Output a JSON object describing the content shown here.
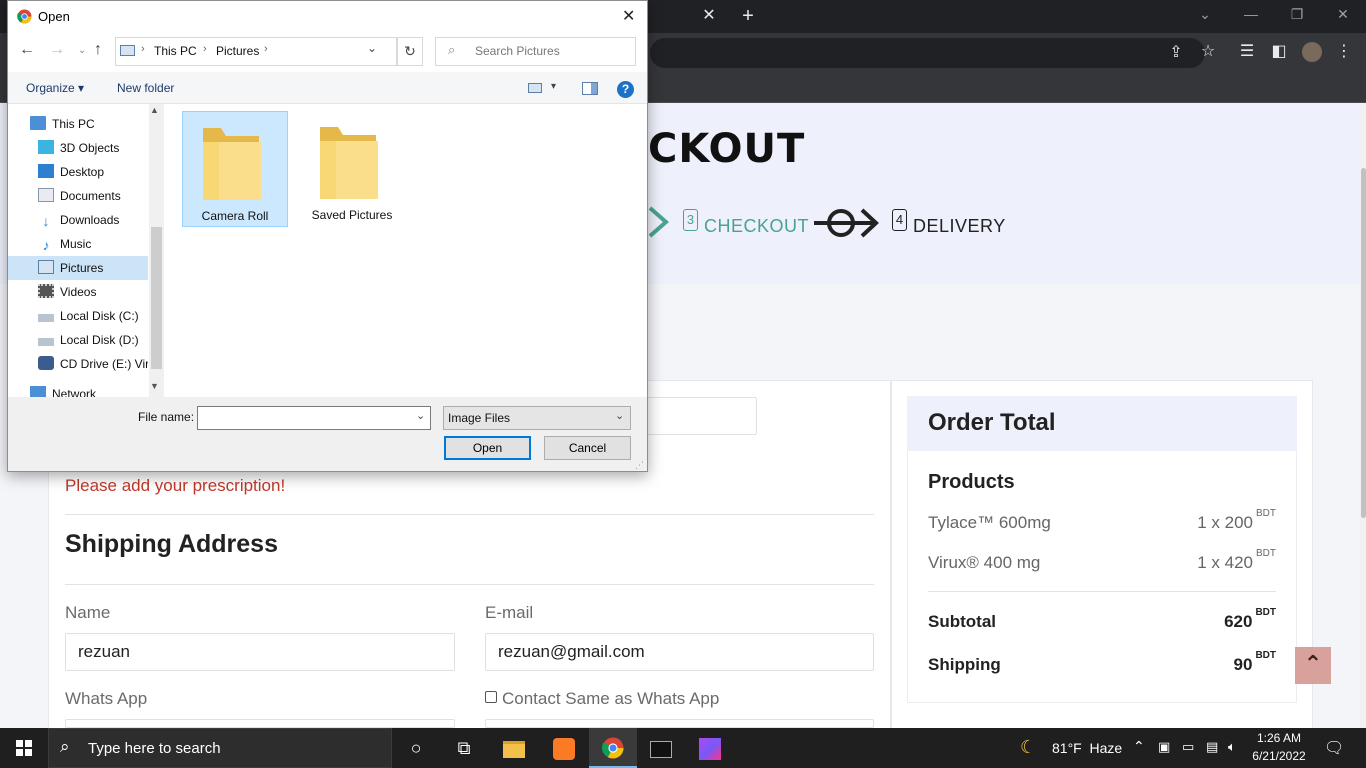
{
  "browser": {
    "colors": {
      "tabbar": "#202124",
      "toolbar": "#35363a"
    },
    "icons": [
      "close-tab-icon",
      "new-tab-icon",
      "share-icon",
      "bookmark-star-icon",
      "reading-list-icon",
      "side-panel-icon",
      "profile-avatar",
      "more-menu-icon"
    ]
  },
  "page": {
    "checkout_title": "CKOUT",
    "steps": [
      {
        "num": "3",
        "label": "CHECKOUT"
      },
      {
        "num": "4",
        "label": "DELIVERY"
      }
    ],
    "prescription_error": "Please add your prescription!",
    "shipping_heading": "Shipping Address",
    "name_label": "Name",
    "name_value": "rezuan",
    "email_label": "E-mail",
    "email_value": "rezuan@gmail.com",
    "whatsapp_label": "Whats App",
    "contact_same_label": "Contact Same as Whats App",
    "order_total": {
      "heading": "Order Total",
      "products_heading": "Products",
      "items": [
        {
          "name": "Tylace™ 600mg",
          "qty": "1 x 200",
          "unit": "BDT"
        },
        {
          "name": "Virux® 400 mg",
          "qty": "1 x 420",
          "unit": "BDT"
        }
      ],
      "subtotal_label": "Subtotal",
      "subtotal_value": "620",
      "shipping_label": "Shipping",
      "shipping_value": "90",
      "currency": "BDT"
    },
    "colors": {
      "step_active": "#4aa391",
      "error": "#c0392b",
      "banner": "#eef0fb",
      "scroll_top_btn": "#d9a19b"
    }
  },
  "dialog": {
    "title": "Open",
    "breadcrumb": [
      "This PC",
      "Pictures"
    ],
    "search_placeholder": "Search Pictures",
    "organize_label": "Organize",
    "new_folder_label": "New folder",
    "sidebar": [
      {
        "label": "This PC",
        "icon": "computer-icon",
        "indent": false
      },
      {
        "label": "3D Objects",
        "icon": "cube-icon",
        "indent": true
      },
      {
        "label": "Desktop",
        "icon": "desktop-icon",
        "indent": true
      },
      {
        "label": "Documents",
        "icon": "document-icon",
        "indent": true
      },
      {
        "label": "Downloads",
        "icon": "download-arrow-icon",
        "indent": true
      },
      {
        "label": "Music",
        "icon": "music-note-icon",
        "indent": true
      },
      {
        "label": "Pictures",
        "icon": "pictures-icon",
        "indent": true,
        "selected": true
      },
      {
        "label": "Videos",
        "icon": "film-icon",
        "indent": true
      },
      {
        "label": "Local Disk (C:)",
        "icon": "disk-icon",
        "indent": true
      },
      {
        "label": "Local Disk (D:)",
        "icon": "disk-icon",
        "indent": true
      },
      {
        "label": "CD Drive (E:) Virt",
        "icon": "cd-drive-icon",
        "indent": true
      },
      {
        "label": "Network",
        "icon": "network-icon",
        "indent": false
      }
    ],
    "folders": [
      {
        "label": "Camera Roll",
        "selected": true
      },
      {
        "label": "Saved Pictures",
        "selected": false
      }
    ],
    "file_name_label": "File name:",
    "file_name_value": "",
    "file_type": "Image Files",
    "open_button": "Open",
    "cancel_button": "Cancel"
  },
  "taskbar": {
    "search_placeholder": "Type here to search",
    "weather": "81°F  Haze",
    "time": "1:26 AM",
    "date": "6/21/2022",
    "apps": [
      "file-explorer-icon",
      "xampp-icon",
      "chrome-icon",
      "terminal-icon",
      "phpstorm-icon"
    ]
  }
}
